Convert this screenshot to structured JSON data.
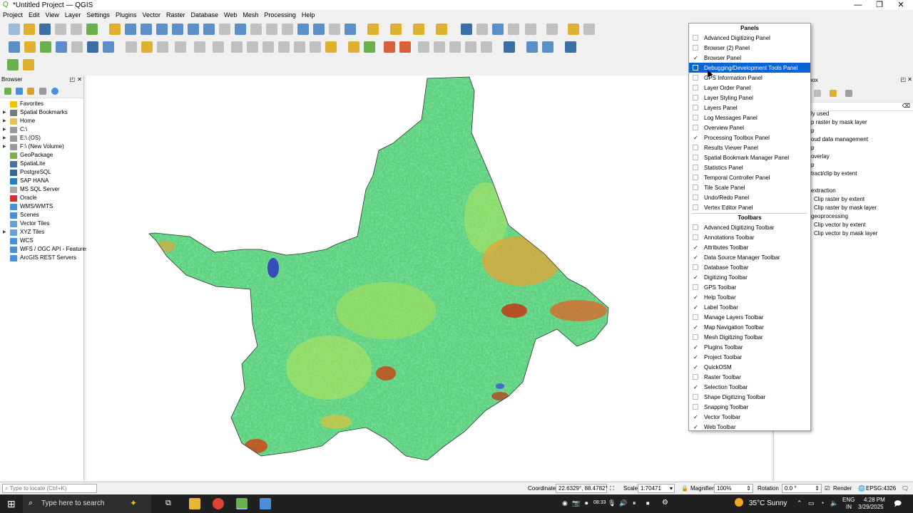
{
  "window": {
    "title": "*Untitled Project — QGIS",
    "min_icon": "minimize-icon",
    "max_icon": "restore-icon",
    "close_icon": "close-icon"
  },
  "menubar": [
    "Project",
    "Edit",
    "View",
    "Layer",
    "Settings",
    "Plugins",
    "Vector",
    "Raster",
    "Database",
    "Web",
    "Mesh",
    "Processing",
    "Help"
  ],
  "browser": {
    "title": "Browser",
    "items": [
      {
        "label": "Favorites",
        "icon": "star-icon",
        "color": "#f2c200",
        "expand": false
      },
      {
        "label": "Spatial Bookmarks",
        "icon": "bookmark-icon",
        "color": "#7a7a7a",
        "expand": true
      },
      {
        "label": "Home",
        "icon": "folder-icon",
        "color": "#e8c15a",
        "expand": true
      },
      {
        "label": "C:\\",
        "icon": "drive-icon",
        "color": "#9a9a9a",
        "expand": true
      },
      {
        "label": "E:\\ (OS)",
        "icon": "drive-icon",
        "color": "#9a9a9a",
        "expand": true
      },
      {
        "label": "F:\\ (New Volume)",
        "icon": "drive-icon",
        "color": "#9a9a9a",
        "expand": true
      },
      {
        "label": "GeoPackage",
        "icon": "geopackage-icon",
        "color": "#7ab04c",
        "expand": false
      },
      {
        "label": "SpatiaLite",
        "icon": "spatialite-icon",
        "color": "#4a6fa5",
        "expand": false
      },
      {
        "label": "PostgreSQL",
        "icon": "postgresql-icon",
        "color": "#336791",
        "expand": false
      },
      {
        "label": "SAP HANA",
        "icon": "saphana-icon",
        "color": "#1e7fc6",
        "expand": false
      },
      {
        "label": "MS SQL Server",
        "icon": "mssql-icon",
        "color": "#a8a8a8",
        "expand": false
      },
      {
        "label": "Oracle",
        "icon": "oracle-icon",
        "color": "#c33",
        "expand": false
      },
      {
        "label": "WMS/WMTS",
        "icon": "wms-icon",
        "color": "#4a90d9",
        "expand": false
      },
      {
        "label": "Scenes",
        "icon": "scenes-icon",
        "color": "#4a90d9",
        "expand": false
      },
      {
        "label": "Vector Tiles",
        "icon": "vectortiles-icon",
        "color": "#6a9fd4",
        "expand": false
      },
      {
        "label": "XYZ Tiles",
        "icon": "xyz-icon",
        "color": "#6a9fd4",
        "expand": true
      },
      {
        "label": "WCS",
        "icon": "wcs-icon",
        "color": "#4a90d9",
        "expand": false
      },
      {
        "label": "WFS / OGC API - Features",
        "icon": "wfs-icon",
        "color": "#4a90d9",
        "expand": false
      },
      {
        "label": "ArcGIS REST Servers",
        "icon": "arcgis-icon",
        "color": "#4a90d9",
        "expand": false
      }
    ]
  },
  "processing": {
    "title": "box",
    "items": [
      "ly used",
      "p raster by mask layer",
      "p",
      "oud data management",
      "p",
      "overlay",
      "p",
      "tract/clip by extent",
      "",
      "extraction",
      "Clip raster by extent",
      "Clip raster by mask layer",
      "geoprocessing",
      "Clip vector by extent",
      "Clip vector by mask layer"
    ]
  },
  "context_menu": {
    "panels_header": "Panels",
    "panels": [
      {
        "label": "Advanced Digitizing Panel",
        "checked": false
      },
      {
        "label": "Browser (2) Panel",
        "checked": false
      },
      {
        "label": "Browser Panel",
        "checked": true
      },
      {
        "label": "Debugging/Development Tools Panel",
        "checked": false,
        "highlighted": true
      },
      {
        "label": "GPS Information Panel",
        "checked": false
      },
      {
        "label": "Layer Order Panel",
        "checked": false
      },
      {
        "label": "Layer Styling Panel",
        "checked": false
      },
      {
        "label": "Layers Panel",
        "checked": false
      },
      {
        "label": "Log Messages Panel",
        "checked": false
      },
      {
        "label": "Overview Panel",
        "checked": false
      },
      {
        "label": "Processing Toolbox Panel",
        "checked": true
      },
      {
        "label": "Results Viewer Panel",
        "checked": false
      },
      {
        "label": "Spatial Bookmark Manager Panel",
        "checked": false
      },
      {
        "label": "Statistics Panel",
        "checked": false
      },
      {
        "label": "Temporal Controller Panel",
        "checked": false
      },
      {
        "label": "Tile Scale Panel",
        "checked": false
      },
      {
        "label": "Undo/Redo Panel",
        "checked": false
      },
      {
        "label": "Vertex Editor Panel",
        "checked": false
      }
    ],
    "toolbars_header": "Toolbars",
    "toolbars": [
      {
        "label": "Advanced Digitizing Toolbar",
        "checked": false
      },
      {
        "label": "Annotations Toolbar",
        "checked": false
      },
      {
        "label": "Attributes Toolbar",
        "checked": true
      },
      {
        "label": "Data Source Manager Toolbar",
        "checked": true
      },
      {
        "label": "Database Toolbar",
        "checked": false
      },
      {
        "label": "Digitizing Toolbar",
        "checked": true
      },
      {
        "label": "GPS Toolbar",
        "checked": false
      },
      {
        "label": "Help Toolbar",
        "checked": true
      },
      {
        "label": "Label Toolbar",
        "checked": true
      },
      {
        "label": "Manage Layers Toolbar",
        "checked": false
      },
      {
        "label": "Map Navigation Toolbar",
        "checked": true
      },
      {
        "label": "Mesh Digitizing Toolbar",
        "checked": false
      },
      {
        "label": "Plugins Toolbar",
        "checked": true
      },
      {
        "label": "Project Toolbar",
        "checked": true
      },
      {
        "label": "QuickOSM",
        "checked": true
      },
      {
        "label": "Raster Toolbar",
        "checked": false
      },
      {
        "label": "Selection Toolbar",
        "checked": true
      },
      {
        "label": "Shape Digitizing Toolbar",
        "checked": false
      },
      {
        "label": "Snapping Toolbar",
        "checked": false
      },
      {
        "label": "Vector Toolbar",
        "checked": true
      },
      {
        "label": "Web Toolbar",
        "checked": true
      }
    ]
  },
  "statusbar": {
    "locate_placeholder": "Type to locate (Ctrl+K)",
    "coordinate_label": "Coordinate",
    "coordinate_value": "22.6329°, 88.4782°",
    "scale_label": "Scale",
    "scale_value": "1:70471",
    "magnifier_label": "Magnifier",
    "magnifier_value": "100%",
    "rotation_label": "Rotation",
    "rotation_value": "0.0 °",
    "render_label": "Render",
    "crs": "EPSG:4326"
  },
  "taskbar": {
    "search_placeholder": "Type here to search",
    "weather": "35°C  Sunny",
    "lang1": "ENG",
    "lang2": "IN",
    "time": "4:28 PM",
    "date": "3/29/2025",
    "clock_small": "08:33"
  }
}
